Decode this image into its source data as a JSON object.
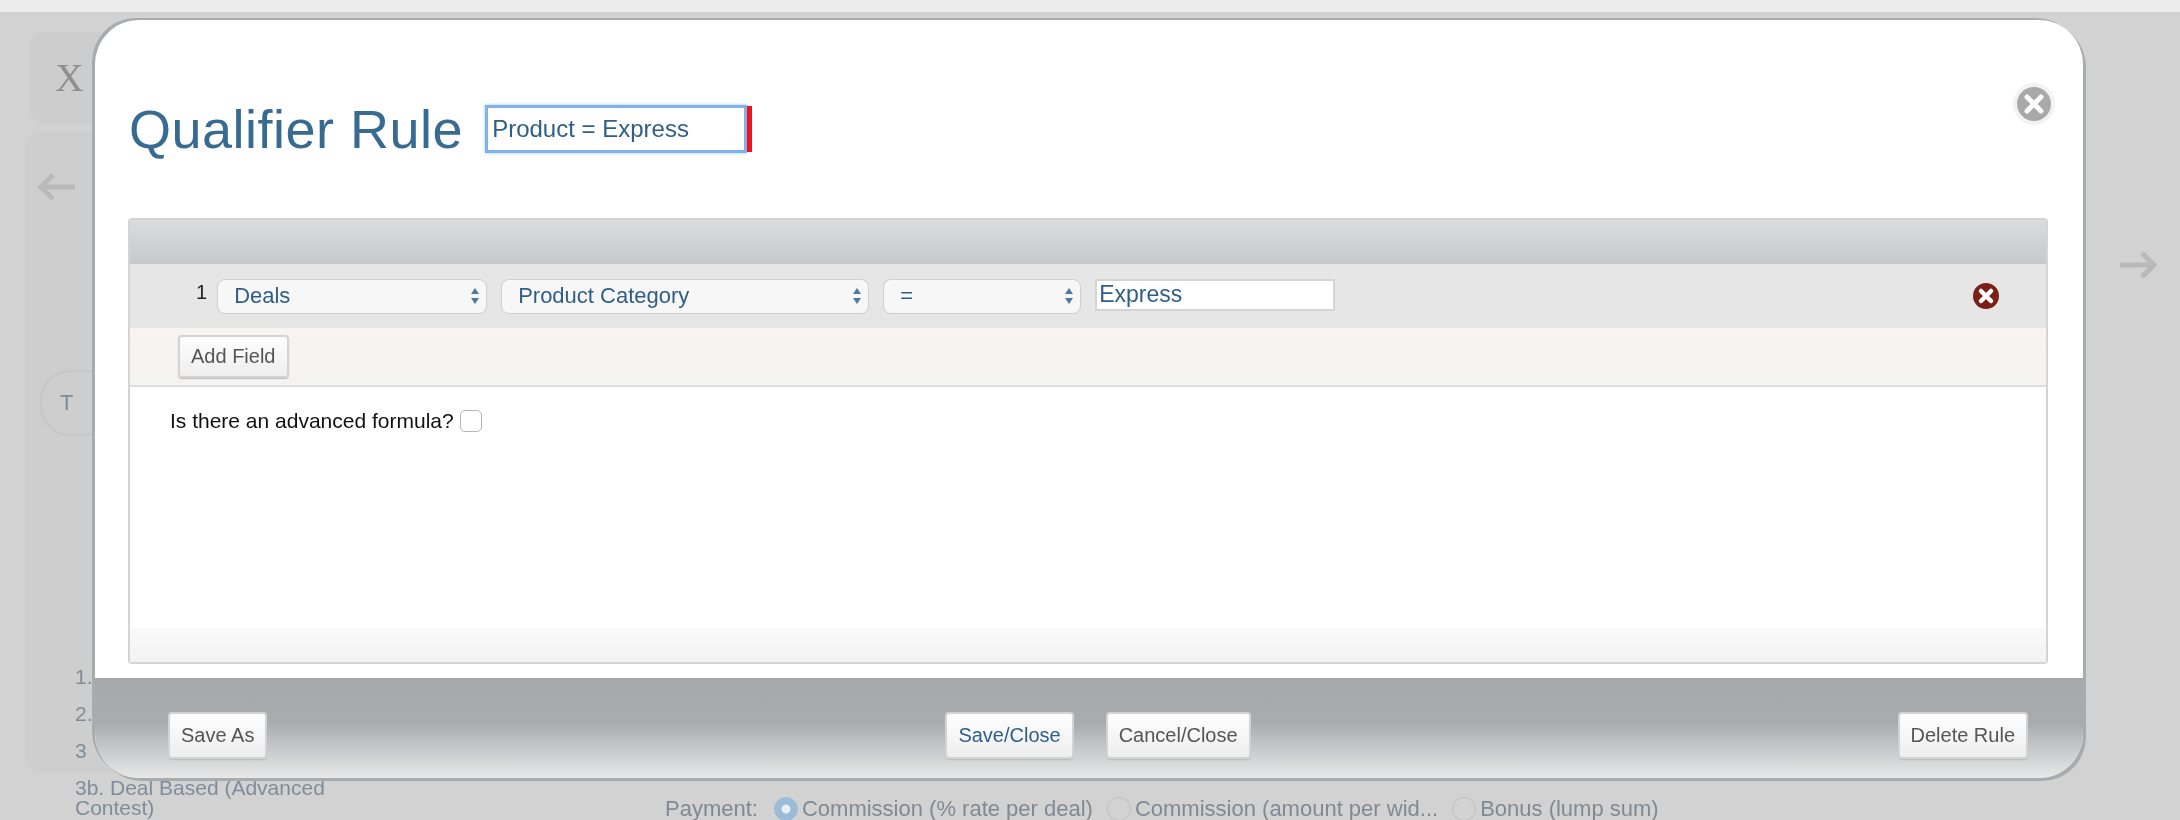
{
  "background": {
    "header_text": "X",
    "tab_text": "T",
    "steps": [
      "1.",
      "2.",
      "3",
      "3b. Deal Based (Advanced Contest)"
    ],
    "payment": {
      "label": "Payment:",
      "options": [
        {
          "label": "Commission (% rate per deal)",
          "selected": true
        },
        {
          "label": "Commission (amount per wid...",
          "selected": false
        },
        {
          "label": "Bonus (lump sum)",
          "selected": false
        }
      ]
    }
  },
  "dialog": {
    "title": "Qualifier Rule",
    "name_value": "Product = Express",
    "conditions": [
      {
        "number": "1",
        "source": "Deals",
        "field": "Product Category",
        "operator": "=",
        "value": "Express"
      }
    ],
    "add_button": "Add Field",
    "advanced": {
      "label": "Is there an advanced formula?",
      "checked": false
    },
    "buttons": [
      {
        "label": "Save As",
        "kind": "left"
      },
      {
        "label": "Save/Close",
        "kind": "primary"
      },
      {
        "label": "Cancel/Close",
        "kind": "center"
      },
      {
        "label": "Delete Rule",
        "kind": "right"
      }
    ]
  }
}
